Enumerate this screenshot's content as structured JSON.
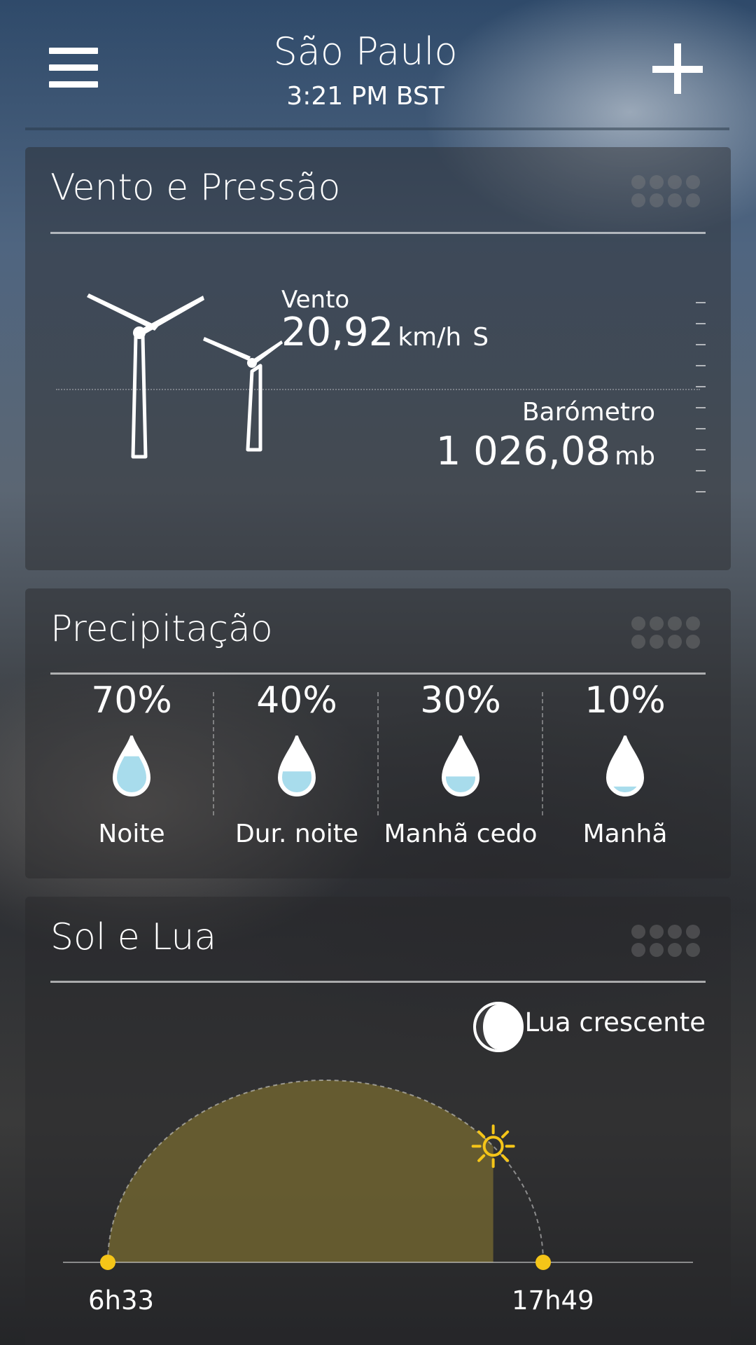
{
  "header": {
    "city": "São Paulo",
    "time": "3:21 PM BST"
  },
  "wind_pressure": {
    "title": "Vento e Pressão",
    "wind_label": "Vento",
    "wind_speed": "20,92",
    "wind_unit": "km/h",
    "wind_direction": "S",
    "barometer_label": "Barómetro",
    "barometer_value": "1 026,08",
    "barometer_unit": "mb"
  },
  "precipitation": {
    "title": "Precipitação",
    "items": [
      {
        "percent": "70%",
        "period": "Noite",
        "level": 0.7
      },
      {
        "percent": "40%",
        "period": "Dur. noite",
        "level": 0.4
      },
      {
        "percent": "30%",
        "period": "Manhã cedo",
        "level": 0.3
      },
      {
        "percent": "10%",
        "period": "Manhã",
        "level": 0.1
      }
    ]
  },
  "sun_moon": {
    "title": "Sol e Lua",
    "moon_phase": "Lua crescente",
    "sunrise": "6h33",
    "sunset": "17h49",
    "day_progress": 0.78
  },
  "colors": {
    "sun": "#f5c518",
    "water": "#a8dcec",
    "day_fill": "#6f6330"
  }
}
